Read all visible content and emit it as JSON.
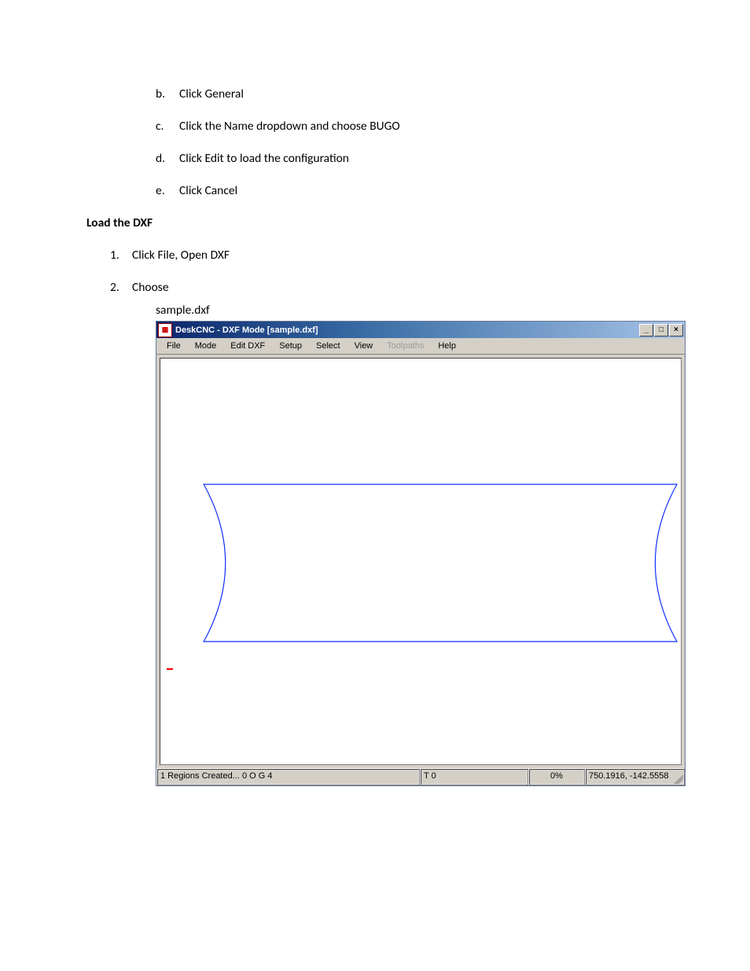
{
  "steps": {
    "b": {
      "marker": "b.",
      "text": "Click General"
    },
    "c": {
      "marker": "c.",
      "text": "Click the Name dropdown and choose BUGO"
    },
    "d": {
      "marker": "d.",
      "text": "Click Edit to load the configuration"
    },
    "e": {
      "marker": "e.",
      "text": "Click Cancel"
    }
  },
  "section_heading": "Load the DXF",
  "numbered": {
    "one": {
      "marker": "1.",
      "text": "Click File, Open DXF"
    },
    "two": {
      "marker": "2.",
      "text": "Choose"
    }
  },
  "sample_filename": "sample.dxf",
  "app": {
    "title": "DeskCNC - DXF Mode [sample.dxf]",
    "menu": {
      "file": "File",
      "mode": "Mode",
      "editdxf": "Edit DXF",
      "setup": "Setup",
      "select": "Select",
      "view": "View",
      "toolpaths": "Toolpaths",
      "help": "Help"
    },
    "status": {
      "regions": "1 Regions Created... 0 O G 4",
      "t": "T 0",
      "pct": "0%",
      "coords": "750.1916, -142.5558"
    },
    "controls": {
      "min": "_",
      "max": "□",
      "close": "×"
    }
  }
}
